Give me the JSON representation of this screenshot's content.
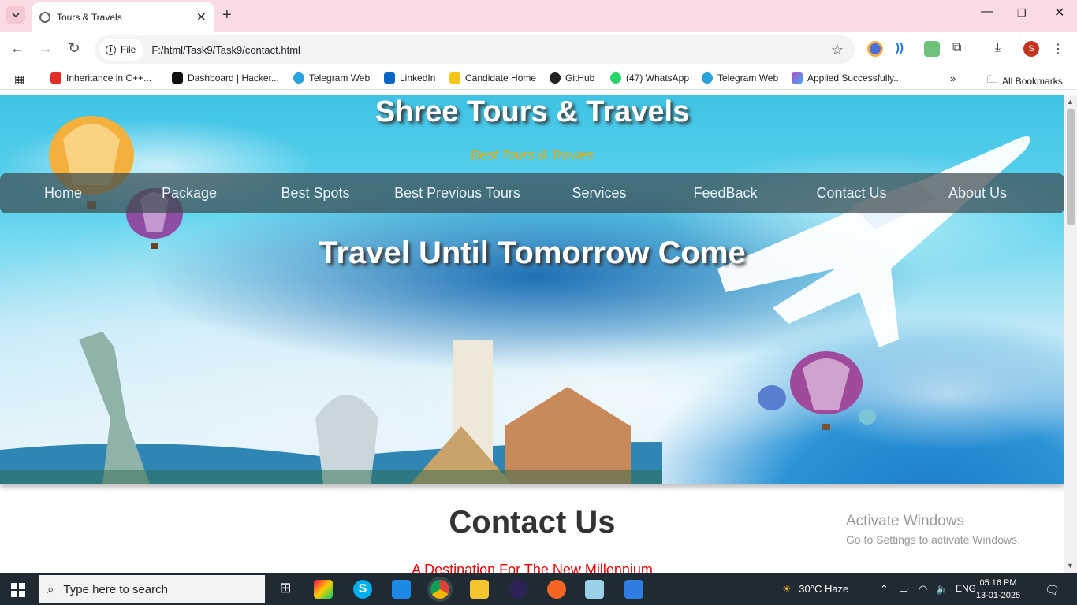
{
  "browser": {
    "tab_title": "Tours & Travels",
    "url_chip": "File",
    "url": "F:/html/Task9/Task9/contact.html",
    "profile_initial": "S",
    "bookmarks": [
      "Inheritance in C++...",
      "Dashboard | Hacker...",
      "Telegram Web",
      "LinkedIn",
      "Candidate Home",
      "GitHub",
      "(47) WhatsApp",
      "Telegram Web",
      "Applied Successfully..."
    ],
    "all_bookmarks": "All Bookmarks"
  },
  "site": {
    "title": "Shree Tours & Travels",
    "tagline": "Best Tours & Travles",
    "nav": [
      "Home",
      "Package",
      "Best Spots",
      "Best Previous Tours",
      "Services",
      "FeedBack",
      "Contact Us",
      "About Us"
    ],
    "hero_heading": "Travel Until Tomorrow Come"
  },
  "contact": {
    "heading": "Contact Us",
    "subheading": "A Destination For The New Millennium"
  },
  "watermark": {
    "line1": "Activate Windows",
    "line2": "Go to Settings to activate Windows."
  },
  "taskbar": {
    "search_placeholder": "Type here to search",
    "weather": "30°C  Haze",
    "language": "ENG",
    "time": "05:16 PM",
    "date": "13-01-2025"
  },
  "colors": {
    "tabbar": "#fbdce4",
    "tagline": "#e8a800",
    "contact_sub": "#ee0000"
  }
}
